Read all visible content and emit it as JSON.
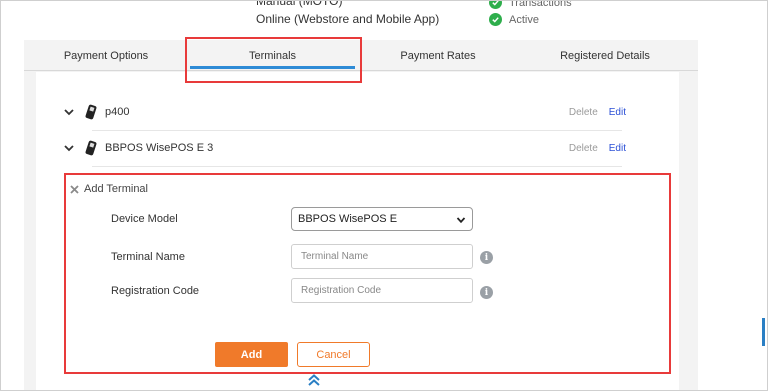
{
  "summary": {
    "method_top": "Manual (MOTO)",
    "method_online": "Online (Webstore and Mobile App)",
    "status_transactions": "Transactions",
    "status_active": "Active"
  },
  "tabs": [
    {
      "label": "Payment Options"
    },
    {
      "label": "Terminals"
    },
    {
      "label": "Payment Rates"
    },
    {
      "label": "Registered Details"
    }
  ],
  "terminals": [
    {
      "name": "p400",
      "delete": "Delete",
      "edit": "Edit"
    },
    {
      "name": "BBPOS WisePOS E 3",
      "delete": "Delete",
      "edit": "Edit"
    }
  ],
  "add_terminal": {
    "title": "Add Terminal",
    "device_model_label": "Device Model",
    "device_model_value": "BBPOS WisePOS E",
    "terminal_name_label": "Terminal Name",
    "terminal_name_placeholder": "Terminal Name",
    "registration_code_label": "Registration Code",
    "registration_code_placeholder": "Registration Code",
    "add_button": "Add",
    "cancel_button": "Cancel",
    "info_glyph": "i"
  },
  "colors": {
    "accent_orange": "#f07a2a",
    "tab_active_blue": "#2e8bd6",
    "highlight_red": "#e83a3a",
    "check_green": "#2eae4c",
    "edit_blue": "#2a4fd6"
  },
  "icons": {
    "status": "check-circle-icon",
    "expand": "chevron-down-icon",
    "device": "card-reader-icon",
    "close": "close-icon",
    "info": "info-icon",
    "select_arrow": "chevron-down-icon",
    "collapse": "double-chevron-up-icon"
  }
}
